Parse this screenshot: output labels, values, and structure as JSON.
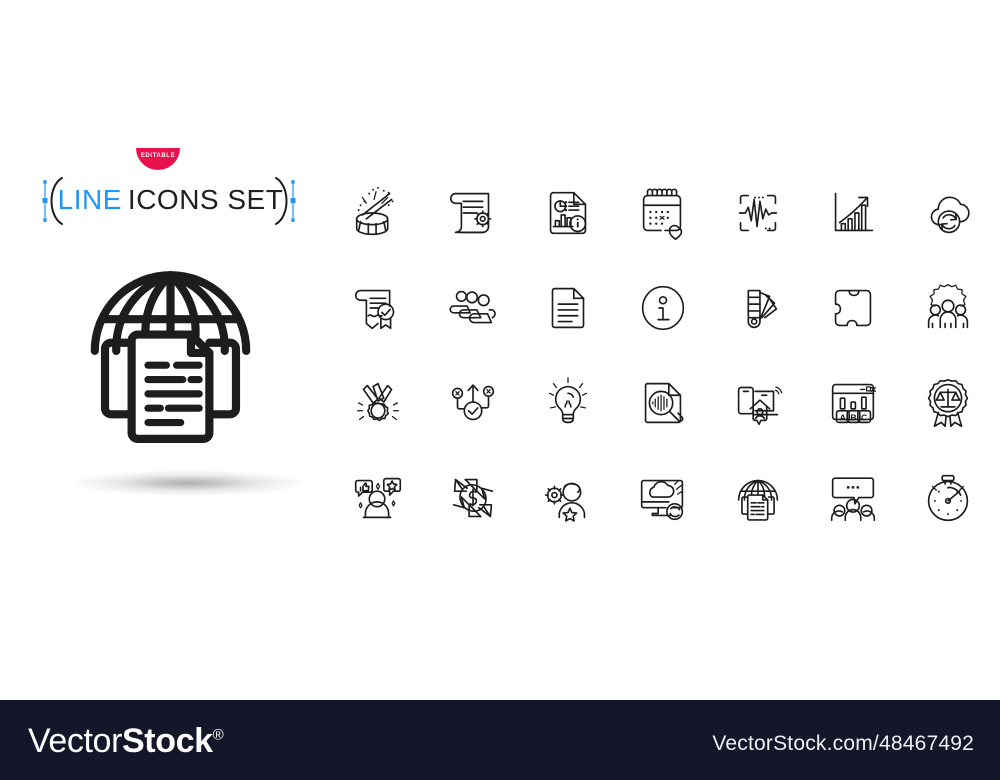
{
  "promo": {
    "badge_label": "EDITABLE",
    "badge_color": "#e8114b",
    "title_accent_word": "LINE",
    "title_rest_words": "ICONS SET",
    "accent_color": "#2196f3",
    "title_color": "#231f20",
    "logo_icon": "global-documentation-icon"
  },
  "grid": {
    "columns": 7,
    "rows": 4,
    "stroke_color": "#1d1d1d",
    "icons": [
      {
        "name": "drums-icon",
        "label": "Drums"
      },
      {
        "name": "technical-documentation-icon",
        "label": "Technical documentation"
      },
      {
        "name": "report-document-icon",
        "label": "Report document"
      },
      {
        "name": "wedding-calendar-icon",
        "label": "Wedding calendar"
      },
      {
        "name": "voice-wave-scan-icon",
        "label": "Voice wave scan"
      },
      {
        "name": "growth-chart-icon",
        "label": "Growth chart"
      },
      {
        "name": "cloud-sync-icon",
        "label": "Cloud sync"
      },
      {
        "name": "diploma-certificate-icon",
        "label": "Diploma certificate"
      },
      {
        "name": "seminar-group-icon",
        "label": "Seminar group"
      },
      {
        "name": "file-document-icon",
        "label": "File document"
      },
      {
        "name": "info-center-icon",
        "label": "Info center"
      },
      {
        "name": "color-palette-icon",
        "label": "Color palette"
      },
      {
        "name": "puzzle-piece-icon",
        "label": "Puzzle piece"
      },
      {
        "name": "teamwork-gear-icon",
        "label": "Teamwork"
      },
      {
        "name": "award-medal-icon",
        "label": "Award medal"
      },
      {
        "name": "correct-way-icon",
        "label": "Correct way"
      },
      {
        "name": "idea-lightbulb-icon",
        "label": "Idea lightbulb"
      },
      {
        "name": "file-analytics-search-icon",
        "label": "File analytics search"
      },
      {
        "name": "work-from-home-icon",
        "label": "Work from home"
      },
      {
        "name": "survey-results-abc-icon",
        "label": "Survey results"
      },
      {
        "name": "justice-scales-award-icon",
        "label": "Justice award"
      },
      {
        "name": "customer-feedback-icon",
        "label": "Customer feedback"
      },
      {
        "name": "money-transfer-icon",
        "label": "Money transfer"
      },
      {
        "name": "employee-skills-icon",
        "label": "Employee skills"
      },
      {
        "name": "computer-cloud-sync-icon",
        "label": "Computer cloud sync"
      },
      {
        "name": "global-documentation-icon",
        "label": "Global documentation"
      },
      {
        "name": "group-discussion-icon",
        "label": "Group discussion"
      },
      {
        "name": "stopwatch-timer-icon",
        "label": "Stopwatch timer"
      }
    ],
    "survey_bar_labels": [
      "A",
      "B",
      "C"
    ]
  },
  "footer": {
    "brand_light": "Vector",
    "brand_bold": "Stock",
    "brand_mark": "®",
    "url": "VectorStock.com/48467492",
    "background_color": "#14162a"
  }
}
